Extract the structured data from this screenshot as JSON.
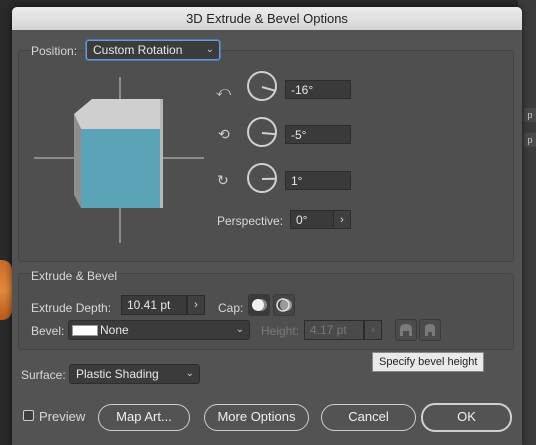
{
  "dialog": {
    "title": "3D Extrude & Bevel Options"
  },
  "position": {
    "label": "Position:",
    "selected": "Custom Rotation",
    "x_rotation": "-16°",
    "y_rotation": "-5°",
    "z_rotation": "1°",
    "perspective_label": "Perspective:",
    "perspective_value": "0°"
  },
  "extrude": {
    "section_title": "Extrude & Bevel",
    "depth_label": "Extrude Depth:",
    "depth_value": "10.41 pt",
    "cap_label": "Cap:",
    "bevel_label": "Bevel:",
    "bevel_value": "None",
    "height_label": "Height:",
    "height_value": "4.17 pt"
  },
  "tooltip": {
    "text": "Specify bevel height"
  },
  "surface": {
    "label": "Surface:",
    "value": "Plastic Shading"
  },
  "buttons": {
    "preview_label": "Preview",
    "map_art": "Map Art...",
    "more_options": "More Options",
    "cancel": "Cancel",
    "ok": "OK"
  },
  "background_app": {
    "tab_letters": [
      "p",
      "p"
    ]
  },
  "colors": {
    "cube_face": "#5ba3b6",
    "cube_top": "#cfcfcf",
    "dialog_bg": "#535353",
    "accent": "#6d9bd1"
  }
}
